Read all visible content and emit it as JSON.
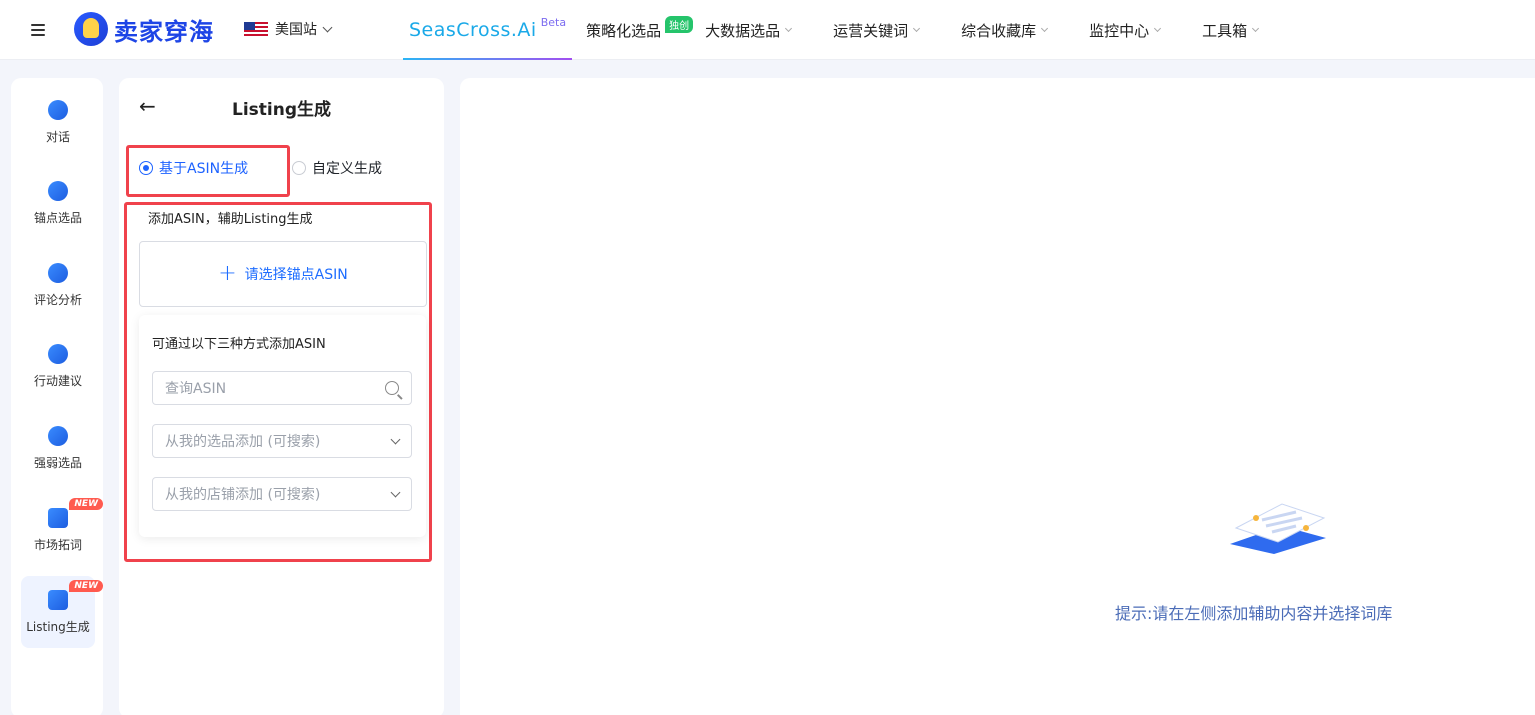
{
  "header": {
    "logo_text": "卖家穿海",
    "site": "美国站",
    "brand": "SeasCross.Ai",
    "brand_badge": "Beta",
    "nav": [
      {
        "label": "策略化选品",
        "badge": "独创"
      },
      {
        "label": "大数据选品"
      },
      {
        "label": "运营关键词"
      },
      {
        "label": "综合收藏库"
      },
      {
        "label": "监控中心"
      },
      {
        "label": "工具箱"
      }
    ]
  },
  "rail": {
    "items": [
      {
        "label": "对话"
      },
      {
        "label": "锚点选品"
      },
      {
        "label": "评论分析"
      },
      {
        "label": "行动建议"
      },
      {
        "label": "强弱选品"
      },
      {
        "label": "市场拓词",
        "badge": "NEW"
      },
      {
        "label": "Listing生成",
        "badge": "NEW",
        "active": true
      }
    ]
  },
  "panel": {
    "title": "Listing生成",
    "back_icon": "←",
    "mode_options": [
      {
        "label": "基于ASIN生成",
        "selected": true
      },
      {
        "label": "自定义生成",
        "selected": false
      }
    ],
    "section_label": "添加ASIN，辅助Listing生成",
    "pick_button": {
      "plus": "+",
      "label": "请选择锚点ASIN"
    },
    "methods": {
      "title": "可通过以下三种方式添加ASIN",
      "search_placeholder": "查询ASIN",
      "select_mine": "从我的选品添加 (可搜索)",
      "select_store": "从我的店铺添加 (可搜索)"
    }
  },
  "main": {
    "hint": "提示:请在左侧添加辅助内容并选择词库"
  },
  "colors": {
    "accent": "#1e63ff",
    "highlight": "#f0424c",
    "new_badge": "#ff5a4f",
    "exclusive_badge": "#25c46b"
  }
}
